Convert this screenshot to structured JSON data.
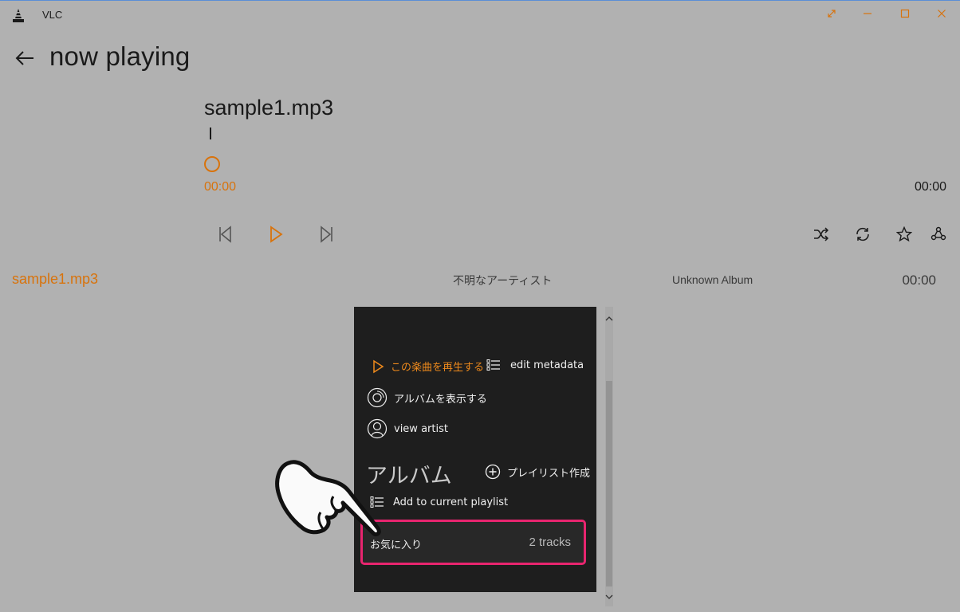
{
  "window": {
    "app_name": "VLC",
    "buttons": [
      "expand-icon",
      "minimize-icon",
      "maximize-icon",
      "close-icon"
    ],
    "accent_color": "#d8730c"
  },
  "header": {
    "title": "now playing"
  },
  "now_playing": {
    "track_title": "sample1.mp3",
    "time_elapsed": "00:00",
    "time_total": "00:00",
    "progress": 0
  },
  "controls": {
    "transport": [
      "previous-icon",
      "play-icon",
      "next-icon"
    ],
    "right": [
      "shuffle-icon",
      "repeat-icon",
      "favorite-star-icon",
      "share-icon"
    ]
  },
  "track_row": {
    "title": "sample1.mp3",
    "artist": "不明なアーティスト",
    "album": "Unknown Album",
    "duration": "00:00"
  },
  "flyout": {
    "play_track": "この楽曲を再生する",
    "edit_metadata": "edit metadata",
    "view_album": "アルバムを表示する",
    "view_artist": "view artist",
    "section_heading": "アルバム",
    "create_playlist": "プレイリスト作成",
    "add_to_current": "Add to current playlist",
    "playlist": {
      "name": "お気に入り",
      "count": "2 tracks",
      "highlight_color": "#e8256f"
    }
  }
}
